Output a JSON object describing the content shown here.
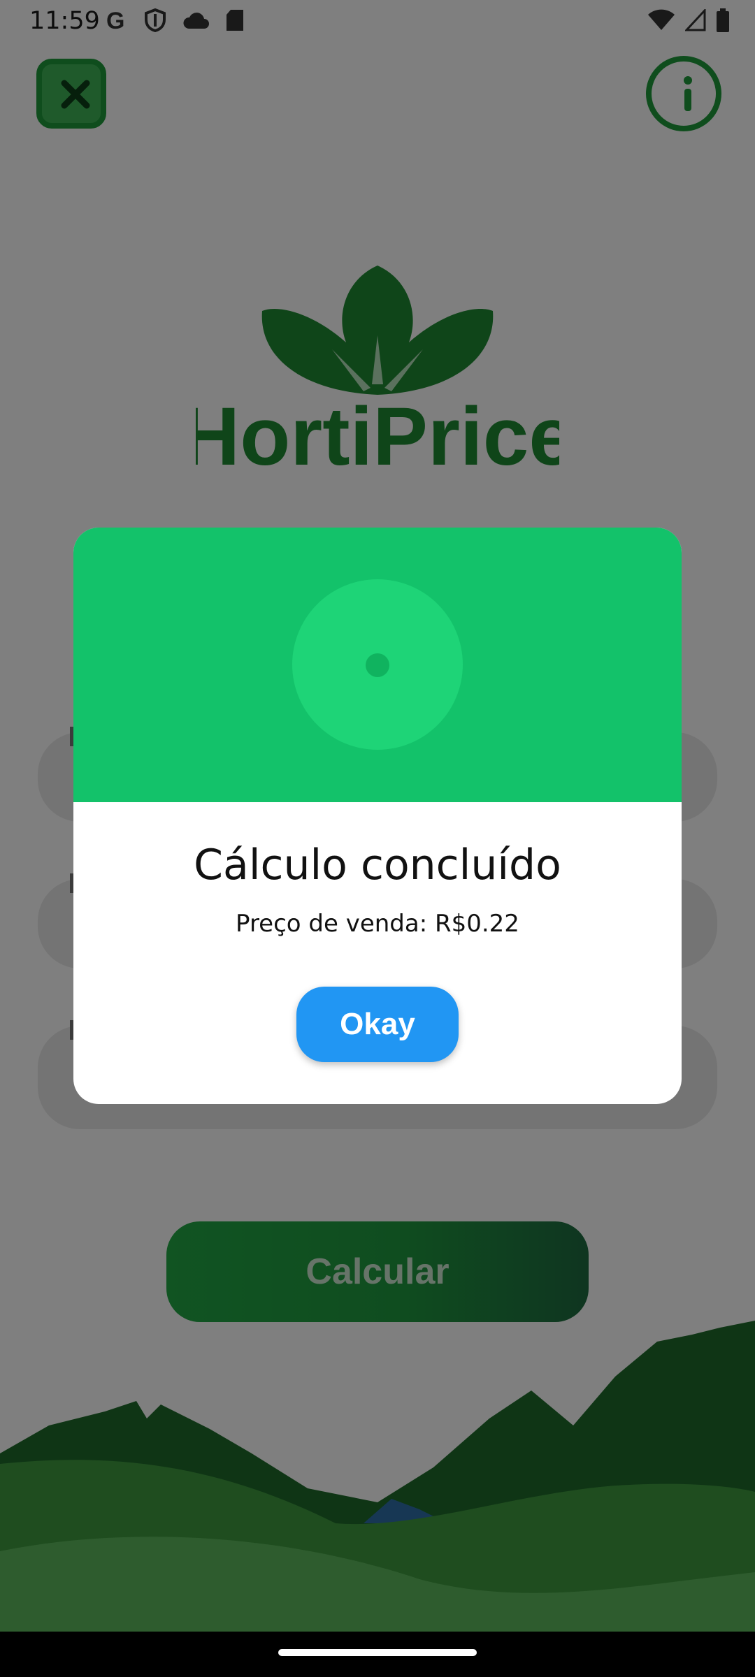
{
  "status_bar": {
    "time": "11:59",
    "left_icons": [
      "google-icon",
      "shield-icon",
      "cloud-icon",
      "sd-card-icon"
    ],
    "right_icons": [
      "wifi-icon",
      "signal-icon",
      "battery-icon"
    ]
  },
  "app": {
    "logo_text": "HortiPrice",
    "calculate_label": "Calcular",
    "colors": {
      "brand_green": "#1e9b3a",
      "dialog_header": "#13c26a",
      "button_blue": "#2196f3"
    }
  },
  "dialog": {
    "title": "Cálculo concluído",
    "message": "Preço de venda: R$0.22",
    "okay_label": "Okay"
  }
}
